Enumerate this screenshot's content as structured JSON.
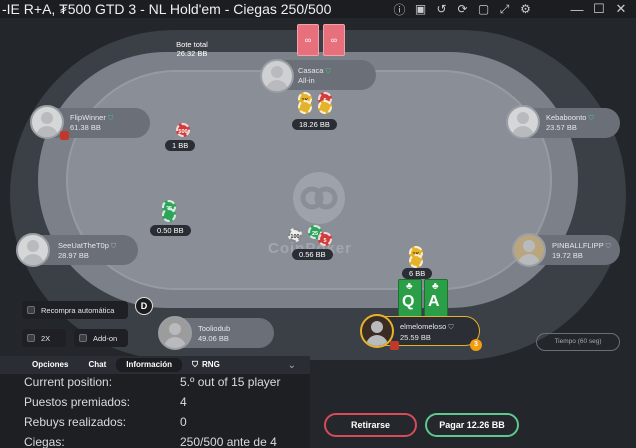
{
  "window": {
    "title": "‑IE R+A, ₮500 GTD 3 - NL Hold'em - Ciegas 250/500",
    "icons": [
      "info-icon",
      "wallet-icon",
      "history-icon",
      "replay-icon",
      "screenshot-icon",
      "fullscreen-icon",
      "settings-icon"
    ],
    "controls": [
      "minimize-icon",
      "maximize-icon",
      "close-icon"
    ]
  },
  "pot": {
    "label": "Bote total",
    "amount": "26.32 BB"
  },
  "brand_logo_text": "CoinPoker",
  "players": {
    "casaca": {
      "name": "Casaca",
      "status": "All-in",
      "bet": "18.26 BB",
      "bet_chips": [
        "1K",
        "5"
      ]
    },
    "flipwinner": {
      "name": "FlipWinner",
      "stack": "61.38 BB",
      "bet": "1 BB",
      "bet_chips": [
        "500"
      ]
    },
    "kebaboonto": {
      "name": "Kebaboonto",
      "stack": "23.57 BB"
    },
    "seeuat": {
      "name": "SeeUatTheT0p",
      "stack": "28.97 BB",
      "bet": "0.50 BB",
      "bet_chips": [
        "25"
      ]
    },
    "pinball": {
      "name": "PINBALLFLIPP",
      "stack": "19.72 BB"
    },
    "toolio": {
      "name": "Tooliodub",
      "stack": "49.06 BB"
    },
    "hero": {
      "name": "elmelomeloso",
      "stack": "25.59 BB",
      "bet": "6 BB",
      "bet_chips": [
        "1K"
      ],
      "cards": [
        {
          "rank": "Q",
          "suit": "♣"
        },
        {
          "rank": "A",
          "suit": "♣"
        }
      ],
      "level_badge": "3"
    }
  },
  "center_bet": {
    "amount": "0.56 BB",
    "chips": [
      "100",
      "25",
      "5"
    ]
  },
  "dealer_label": "D",
  "options": {
    "auto_rebuy": "Recompra automática",
    "two_x": "2X",
    "add_on": "Add-on",
    "time_bank": "Tiempo (60 seg)"
  },
  "panel": {
    "tabs": [
      "Opciones",
      "Chat",
      "Información",
      "RNG"
    ],
    "active_tab": "Información",
    "rows": [
      {
        "label": "Current position:",
        "value": "5.º out of 15 player"
      },
      {
        "label": "Puestos premiados:",
        "value": "4"
      },
      {
        "label": "Rebuys realizados:",
        "value": "0"
      },
      {
        "label": "Ciegas:",
        "value": "250/500 ante de 4"
      }
    ]
  },
  "actions": {
    "fold": "Retirarse",
    "call": "Pagar 12.26 BB"
  }
}
